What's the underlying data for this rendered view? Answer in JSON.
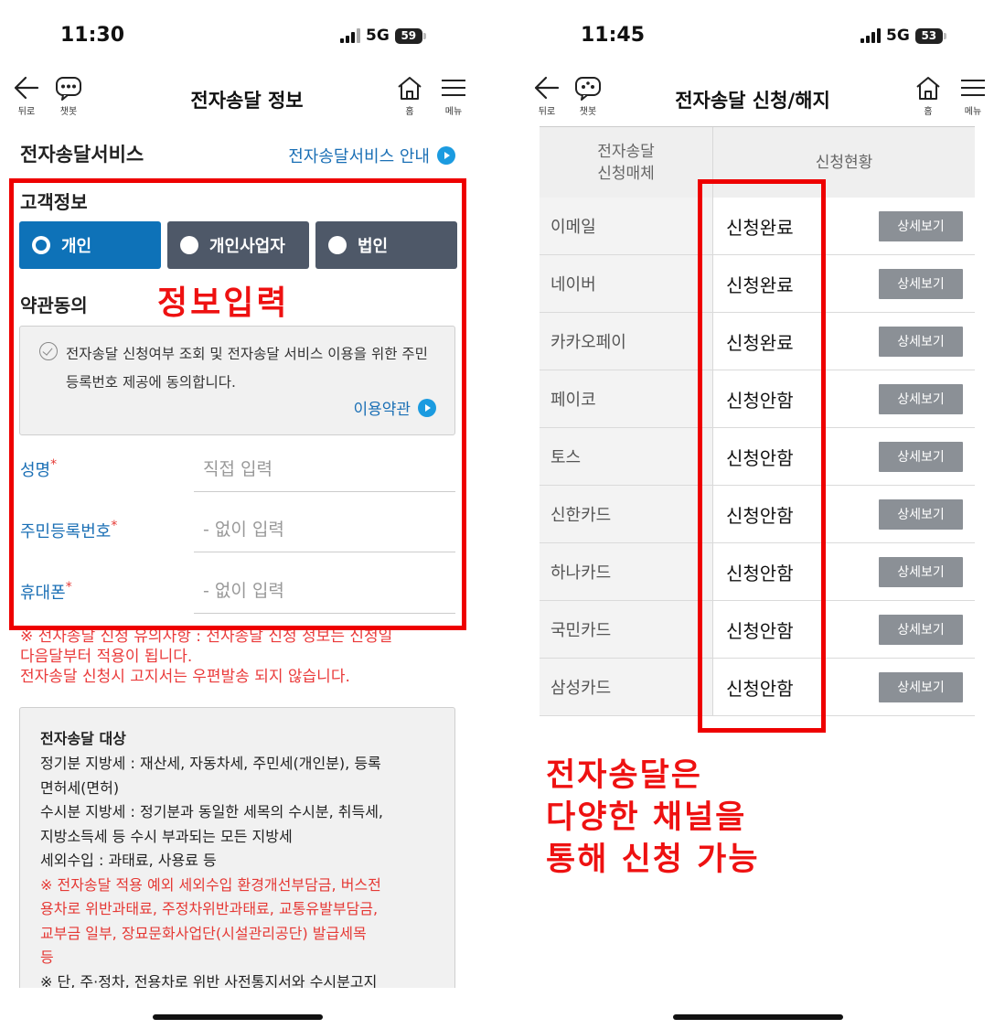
{
  "left": {
    "status": {
      "time": "11:30",
      "network": "5G",
      "battery": "59"
    },
    "nav": {
      "back": "뒤로",
      "chatbot": "챗봇",
      "title": "전자송달 정보",
      "home": "홈",
      "menu": "메뉴"
    },
    "section_title": "전자송달서비스",
    "guide_link": "전자송달서비스 안내",
    "customer_info": "고객정보",
    "customer_types": [
      "개인",
      "개인사업자",
      "법인"
    ],
    "selected_type": "개인",
    "terms_title": "약관동의",
    "terms_text": "전자송달 신청여부 조회 및 전자송달 서비스 이용을 위한 주민등록번호 제공에 동의합니다.",
    "terms_link": "이용약관",
    "fields": [
      {
        "label": "성명",
        "required": "*",
        "placeholder": "직접 입력"
      },
      {
        "label": "주민등록번호",
        "required": "*",
        "placeholder": "- 없이 입력"
      },
      {
        "label": "휴대폰",
        "required": "*",
        "placeholder": "- 없이 입력"
      }
    ],
    "overlay": "정보입력",
    "notice": [
      "※ 전자송달 신청 유의사항 : 전자송달 신청 정보는 신청일",
      "다음달부터 적용이 됩니다.",
      "전자송달 신청시 고지서는 우편발송 되지 않습니다."
    ],
    "target": {
      "title": "전자송달 대상",
      "lines": [
        "정기분 지방세 : 재산세, 자동차세, 주민세(개인분), 등록",
        "면허세(면허)",
        "수시분 지방세 : 정기분과 동일한 세목의 수시분, 취득세,",
        "지방소득세 등 수시 부과되는 모든 지방세",
        "세외수입 : 과태료, 사용료 등"
      ],
      "red_lines": [
        "※ 전자송달 적용 예외 세외수입 환경개선부담금, 버스전",
        "용차로 위반과태료, 주정차위반과태료, 교통유발부담금,",
        "교부금 일부, 장묘문화사업단(시설관리공단) 발급세목",
        "등"
      ],
      "last_line": "※ 단, 주·정차, 전용차로 위반 사전통지서와 수시분고지"
    }
  },
  "right": {
    "status": {
      "time": "11:45",
      "network": "5G",
      "battery": "53"
    },
    "nav": {
      "back": "뒤로",
      "chatbot": "챗봇",
      "title": "전자송달 신청/해지",
      "home": "홈",
      "menu": "메뉴"
    },
    "table": {
      "header_medium_line1": "전자송달",
      "header_medium_line2": "신청매체",
      "header_status": "신청현황",
      "detail_label": "상세보기",
      "rows": [
        {
          "name": "이메일",
          "status": "신청완료"
        },
        {
          "name": "네이버",
          "status": "신청완료"
        },
        {
          "name": "카카오페이",
          "status": "신청완료"
        },
        {
          "name": "페이코",
          "status": "신청안함"
        },
        {
          "name": "토스",
          "status": "신청안함"
        },
        {
          "name": "신한카드",
          "status": "신청안함"
        },
        {
          "name": "하나카드",
          "status": "신청안함"
        },
        {
          "name": "국민카드",
          "status": "신청안함"
        },
        {
          "name": "삼성카드",
          "status": "신청안함"
        }
      ]
    },
    "overlay_lines": [
      "전자송달은",
      "다양한 채널을",
      "통해 신청 가능"
    ]
  },
  "colors": {
    "selected_type": "#0e72b8",
    "unselected_type": "#4e5868",
    "link_blue": "#1a6fb5",
    "annotation_red": "#ee0000",
    "notice_red": "#ea3a3a",
    "detail_button": "#8b9096"
  }
}
